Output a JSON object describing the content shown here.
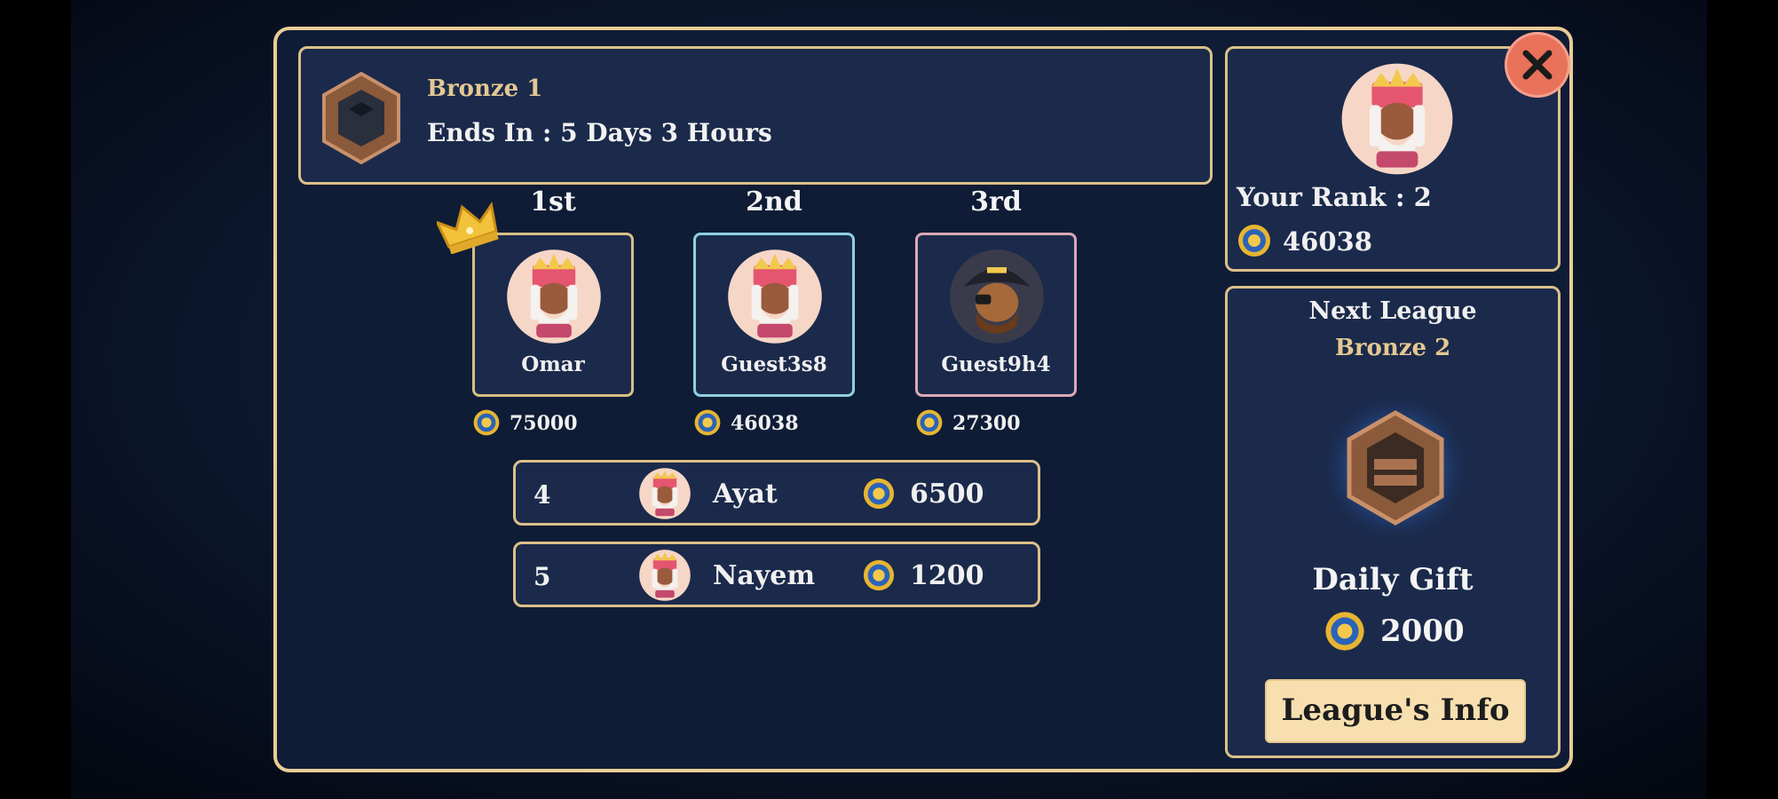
{
  "league": {
    "name": "Bronze 1",
    "ends_in": "Ends In : 5 Days 3 Hours"
  },
  "podium": [
    {
      "place": "1st",
      "name": "Omar",
      "score": "75000",
      "avatar": "king-avatar",
      "border_color": "#d7c084"
    },
    {
      "place": "2nd",
      "name": "Guest3s8",
      "score": "46038",
      "avatar": "king-avatar",
      "border_color": "#8fd0e0"
    },
    {
      "place": "3rd",
      "name": "Guest9h4",
      "score": "27300",
      "avatar": "pirate-avatar",
      "border_color": "#dba8b6"
    }
  ],
  "rows": [
    {
      "rank": "4",
      "name": "Ayat",
      "score": "6500"
    },
    {
      "rank": "5",
      "name": "Nayem",
      "score": "1200"
    }
  ],
  "your_rank": {
    "label": "Your Rank : 2",
    "score": "46038"
  },
  "next_league": {
    "title": "Next League",
    "name": "Bronze 2"
  },
  "daily_gift": {
    "title": "Daily Gift",
    "amount": "2000"
  },
  "buttons": {
    "league_info": "League's Info",
    "close_icon": "close-icon"
  },
  "colors": {
    "panel_border": "#e9cd95",
    "gold_text": "#e4c892",
    "close": "#e8725a",
    "button_bg": "#f7dfb0"
  }
}
